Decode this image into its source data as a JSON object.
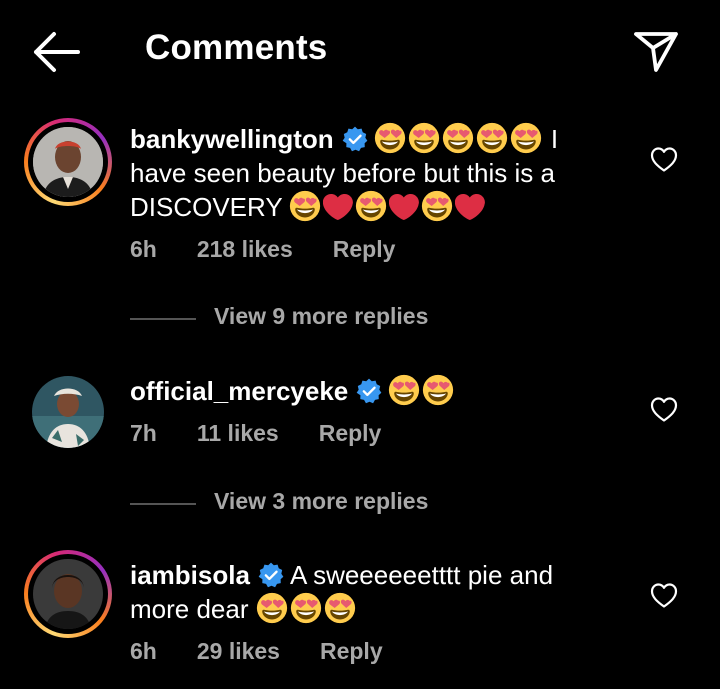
{
  "header": {
    "title": "Comments"
  },
  "comments": [
    {
      "username": "bankywellington",
      "text_line1": "I",
      "text_line2": "have seen beauty before but this is a",
      "text_line3": "DISCOVERY",
      "time": "6h",
      "likes": "218 likes",
      "reply": "Reply",
      "view_more": "View 9 more replies"
    },
    {
      "username": "official_mercyeke",
      "time": "7h",
      "likes": "11 likes",
      "reply": "Reply",
      "view_more": "View 3 more replies"
    },
    {
      "username": "iambisola",
      "text_line1": "A sweeeeeetttt pie and",
      "text_line2": "more dear",
      "time": "6h",
      "likes": "29 likes",
      "reply": "Reply"
    }
  ],
  "colors": {
    "background": "#000000",
    "text": "#ffffff",
    "meta": "#a8a8a8",
    "verified": "#3897f0",
    "heart_emoji": "#dd2e44"
  }
}
